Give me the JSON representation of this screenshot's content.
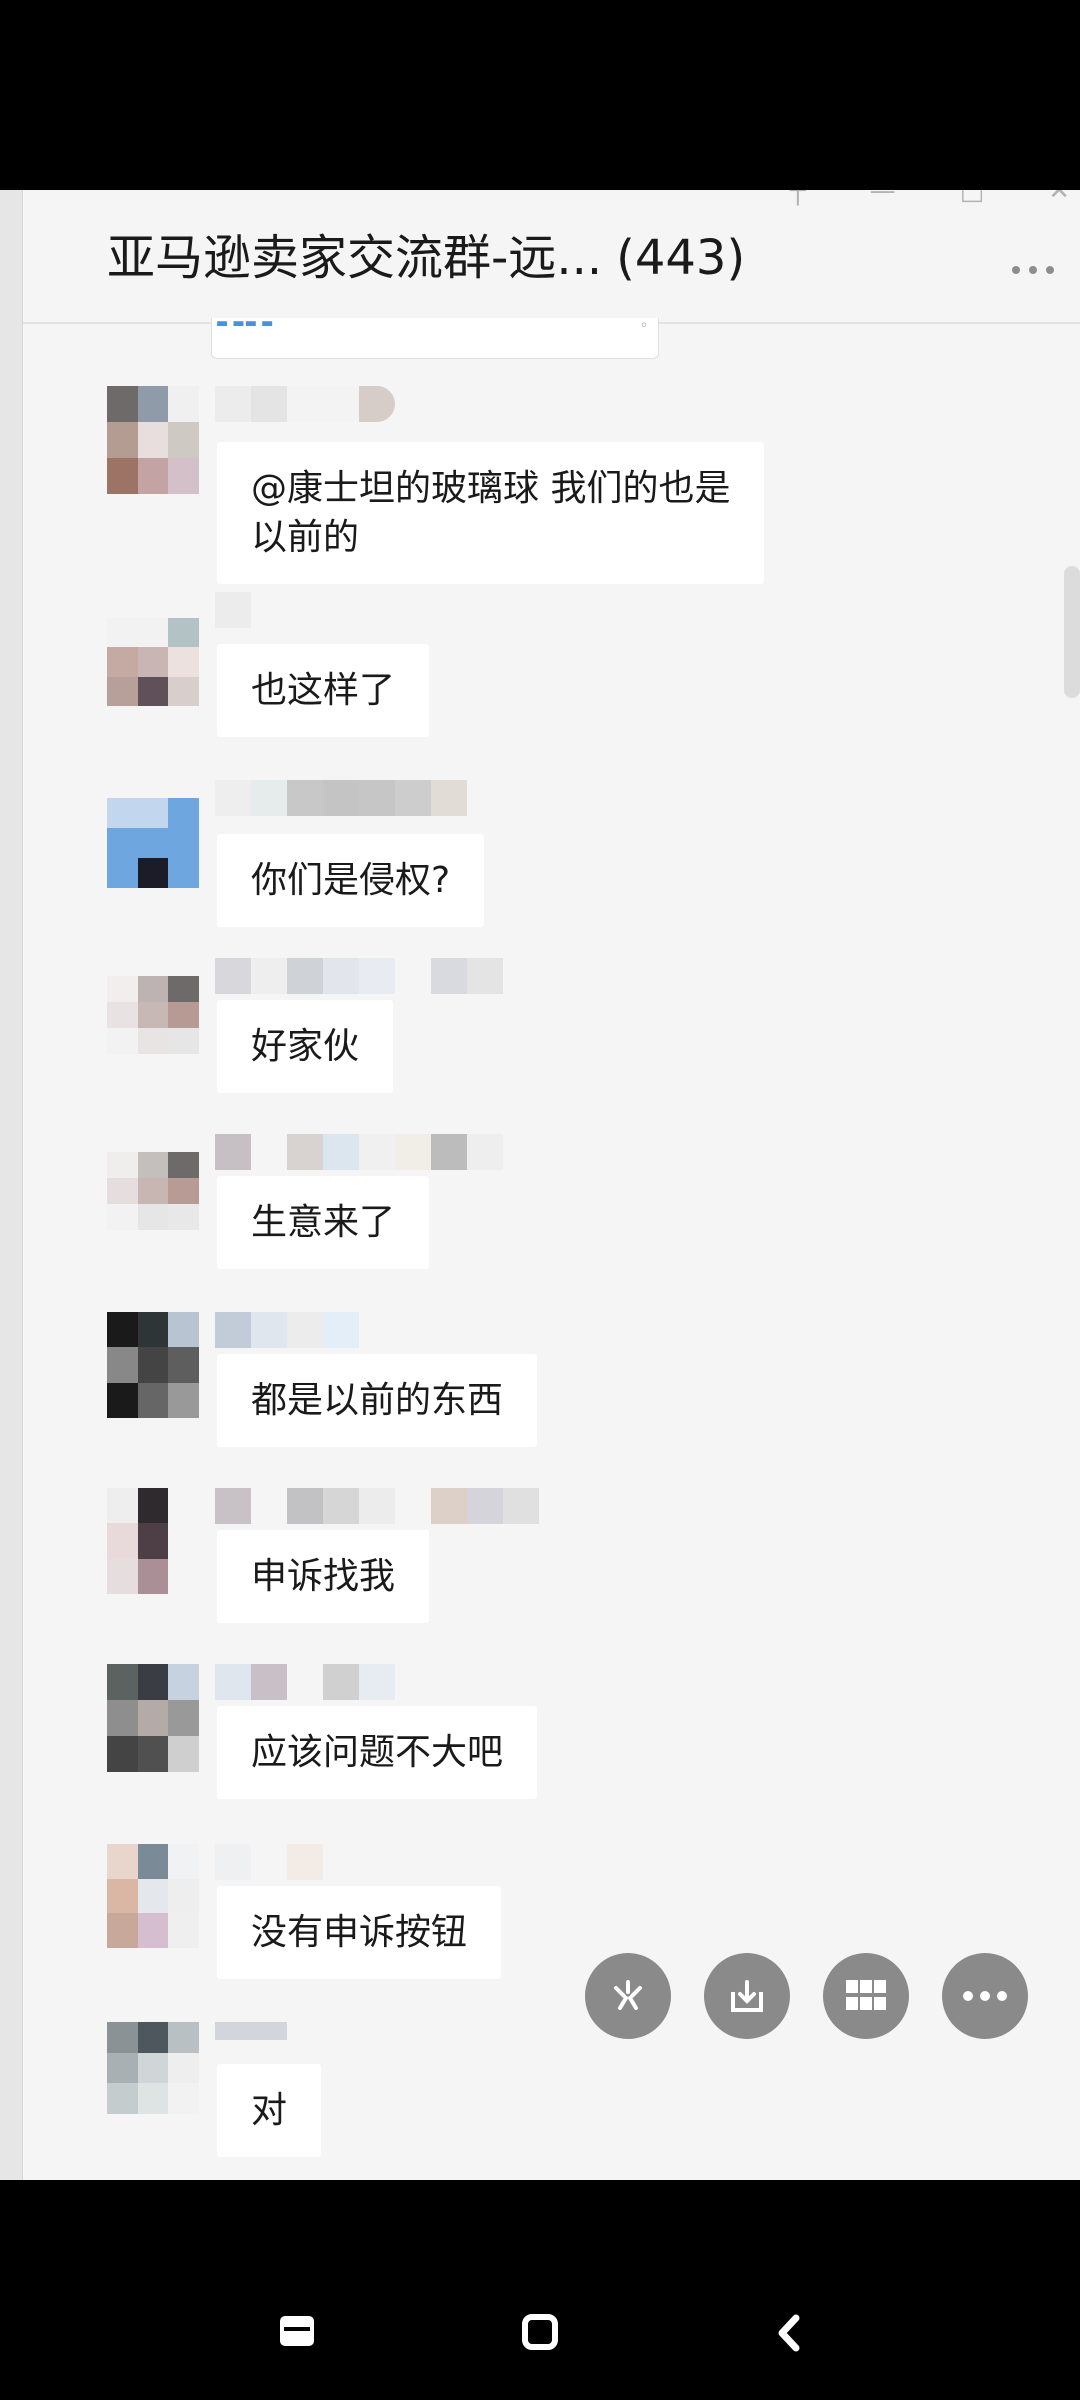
{
  "header": {
    "title": "亚马逊卖家交流群-远...",
    "member_count": "(443)",
    "window_controls": [
      "pin-icon",
      "minimize-icon",
      "maximize-icon",
      "close-icon"
    ]
  },
  "messages": [
    {
      "text": "@康士坦的玻璃球 我们的也是\n以前的"
    },
    {
      "text": "也这样了"
    },
    {
      "text": "你们是侵权?"
    },
    {
      "text": "好家伙"
    },
    {
      "text": "生意来了"
    },
    {
      "text": "都是以前的东西"
    },
    {
      "text": "申诉找我"
    },
    {
      "text": "应该问题不大吧"
    },
    {
      "text": "没有申诉按钮"
    },
    {
      "text": "对"
    }
  ],
  "floating_actions": [
    "shake-icon",
    "download-icon",
    "grid-icon",
    "more-icon"
  ],
  "nav": [
    "recents-icon",
    "home-icon",
    "back-icon"
  ],
  "colors": {
    "background": "#f5f5f5",
    "bubble": "#ffffff",
    "fab": "#8a8a8a"
  }
}
